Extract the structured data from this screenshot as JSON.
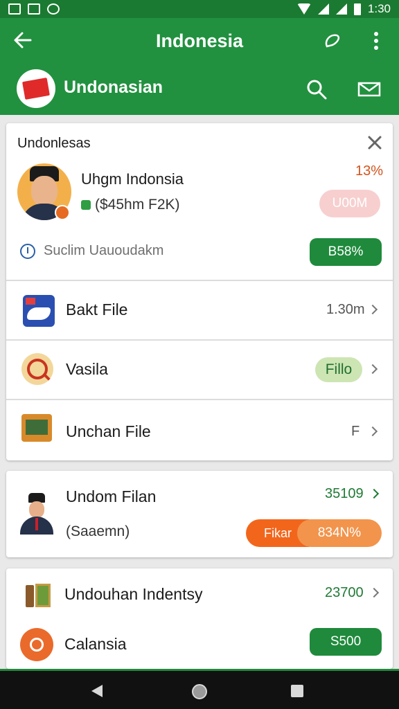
{
  "status_bar": {
    "time": "1:30"
  },
  "app_bar": {
    "title": "Indonesia"
  },
  "sub_bar": {
    "title": "Undonasian"
  },
  "card1": {
    "header": "Undonlesas",
    "profile": {
      "name": "Uhgm Indonsia",
      "subtitle": "($45hm F2K)",
      "percent": "13%",
      "pill": "U00M"
    },
    "meta_text": "Suclim Uauoudakm",
    "meta_pill": "B58%",
    "rows": [
      {
        "label": "Bakt File",
        "value": "1.30m"
      },
      {
        "label": "Vasila",
        "pill": "Fillo"
      },
      {
        "label": "Unchan File",
        "value": "F"
      }
    ]
  },
  "card2": {
    "title": "Undom Filan",
    "subtitle": "(Saaemn)",
    "number": "35109",
    "pill_left": "Fikar",
    "pill_right": "834N%"
  },
  "card3": {
    "row1_label": "Undouhan Indentsy",
    "row1_number": "23700",
    "row2_label": "Calansia",
    "row2_pill": "S500"
  },
  "colors": {
    "appbar": "#21913f",
    "statusbar": "#1b7a31",
    "green_pill": "#1f8a3c",
    "orange": "#f2661c",
    "pink_pill": "#f7cfcf"
  }
}
